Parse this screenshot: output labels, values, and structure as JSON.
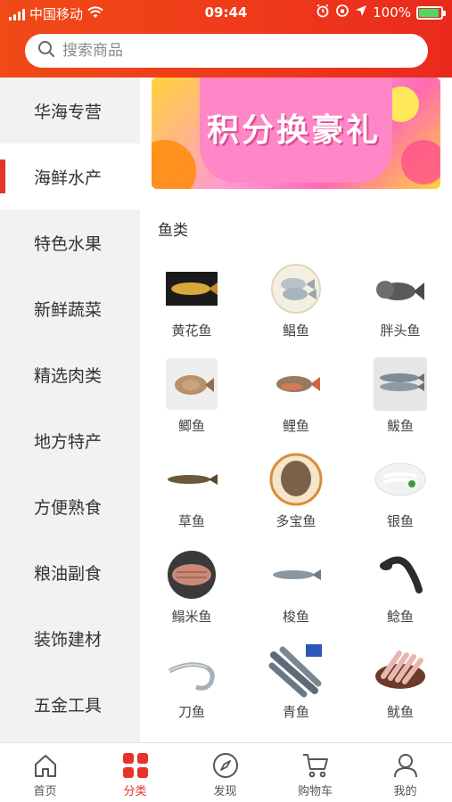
{
  "status_bar": {
    "carrier": "中国移动",
    "time": "09:44",
    "battery": "100%"
  },
  "search": {
    "placeholder": "搜索商品"
  },
  "sidebar": {
    "items": [
      {
        "label": "华海专营",
        "active": false
      },
      {
        "label": "海鲜水产",
        "active": true
      },
      {
        "label": "特色水果",
        "active": false
      },
      {
        "label": "新鲜蔬菜",
        "active": false
      },
      {
        "label": "精选肉类",
        "active": false
      },
      {
        "label": "地方特产",
        "active": false
      },
      {
        "label": "方便熟食",
        "active": false
      },
      {
        "label": "粮油副食",
        "active": false
      },
      {
        "label": "装饰建材",
        "active": false
      },
      {
        "label": "五金工具",
        "active": false
      }
    ]
  },
  "banner": {
    "text": "积分换豪礼"
  },
  "section": {
    "title": "鱼类"
  },
  "products": [
    {
      "name": "黄花鱼",
      "icon": "yellow-croaker-image"
    },
    {
      "name": "鲳鱼",
      "icon": "pomfret-image"
    },
    {
      "name": "胖头鱼",
      "icon": "bighead-carp-image"
    },
    {
      "name": "鲫鱼",
      "icon": "crucian-carp-image"
    },
    {
      "name": "鲤鱼",
      "icon": "carp-image"
    },
    {
      "name": "鲅鱼",
      "icon": "spanish-mackerel-image"
    },
    {
      "name": "草鱼",
      "icon": "grass-carp-image"
    },
    {
      "name": "多宝鱼",
      "icon": "turbot-image"
    },
    {
      "name": "银鱼",
      "icon": "whitebait-image"
    },
    {
      "name": "鳎米鱼",
      "icon": "sole-image"
    },
    {
      "name": "梭鱼",
      "icon": "mullet-image"
    },
    {
      "name": "鲶鱼",
      "icon": "catfish-image"
    },
    {
      "name": "刀鱼",
      "icon": "hairtail-image"
    },
    {
      "name": "青鱼",
      "icon": "black-carp-image"
    },
    {
      "name": "鱿鱼",
      "icon": "squid-image"
    }
  ],
  "tabbar": {
    "items": [
      {
        "label": "首页",
        "icon": "home-icon",
        "active": false
      },
      {
        "label": "分类",
        "icon": "category-icon",
        "active": true
      },
      {
        "label": "发现",
        "icon": "compass-icon",
        "active": false
      },
      {
        "label": "购物车",
        "icon": "cart-icon",
        "active": false
      },
      {
        "label": "我的",
        "icon": "user-icon",
        "active": false
      }
    ]
  },
  "colors": {
    "accent": "#e5332a",
    "header": "#ef3a1a"
  }
}
